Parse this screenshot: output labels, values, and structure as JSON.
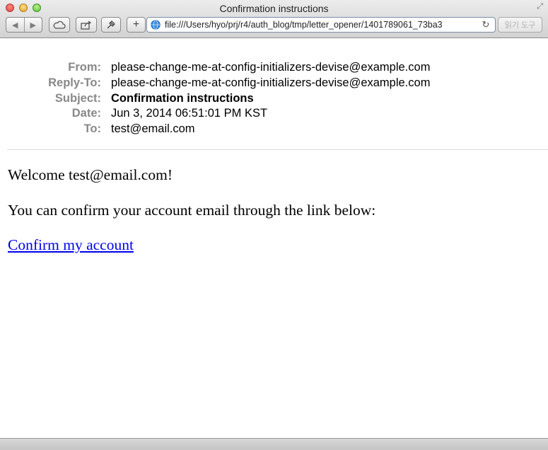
{
  "window": {
    "title": "Confirmation instructions"
  },
  "toolbar": {
    "url": "file:///Users/hyo/prj/r4/auth_blog/tmp/letter_opener/1401789061_73ba3",
    "reader_label": "읽기 도구",
    "add_label": "+",
    "back_icon": "back-arrow-icon",
    "forward_icon": "forward-arrow-icon",
    "reload_icon": "reload-icon"
  },
  "email": {
    "headers": [
      {
        "label": "From:",
        "value": "please-change-me-at-config-initializers-devise@example.com"
      },
      {
        "label": "Reply-To:",
        "value": "please-change-me-at-config-initializers-devise@example.com"
      },
      {
        "label": "Subject:",
        "value": "Confirmation instructions"
      },
      {
        "label": "Date:",
        "value": "Jun 3, 2014 06:51:01 PM KST"
      },
      {
        "label": "To:",
        "value": "test@email.com"
      }
    ],
    "body": {
      "welcome": "Welcome test@email.com!",
      "instruction": "You can confirm your account email through the link below:",
      "link_text": "Confirm my account"
    }
  },
  "colors": {
    "link": "#0000ee",
    "header_label": "#888888"
  }
}
